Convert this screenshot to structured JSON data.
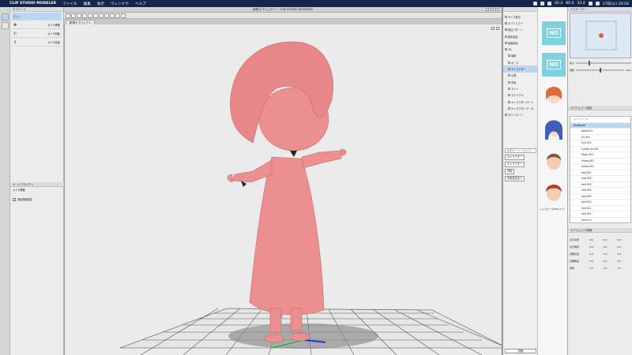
{
  "menubar": {
    "apple": "",
    "app": "CLIP STUDIO MODELER",
    "items": [
      "ファイル",
      "編集",
      "表示",
      "ウィンドウ",
      "ヘルプ"
    ],
    "status": [
      "92.4",
      "80.4",
      "33.4"
    ],
    "clock": "17日(火) 20:54"
  },
  "subtool_panel": {
    "title": "サブツール",
    "items": [
      {
        "label": "ビュー",
        "glyph": "✋"
      },
      {
        "label": "カメラ移動",
        "glyph": "✥"
      },
      {
        "label": "カメラ回転",
        "glyph": "↻"
      },
      {
        "label": "カメラ前後",
        "glyph": "⇕"
      }
    ]
  },
  "tool_property": {
    "title": "ツールプロパティ",
    "subtitle": "カメラ移動",
    "option": "回転角度固定"
  },
  "document": {
    "title": "新規オブジェクト* - CLIP STUDIO MODELER",
    "tab": "新規オブジェクト"
  },
  "object_tree": {
    "items": [
      {
        "label": "サイズ表示",
        "indent": false,
        "selected": false
      },
      {
        "label": "オブジェクト",
        "indent": false,
        "selected": false
      },
      {
        "label": "視点パターン",
        "indent": false,
        "selected": false
      },
      {
        "label": "基本設定",
        "indent": false,
        "selected": false
      },
      {
        "label": "画面設定",
        "indent": false,
        "selected": false
      },
      {
        "label": "3D",
        "indent": false,
        "selected": false
      },
      {
        "label": "頭部",
        "indent": true,
        "selected": false
      },
      {
        "label": "ポーズ",
        "indent": true,
        "selected": false
      },
      {
        "label": "キャラクター",
        "indent": true,
        "selected": true
      },
      {
        "label": "小物",
        "indent": true,
        "selected": false
      },
      {
        "label": "背景",
        "indent": true,
        "selected": false
      },
      {
        "label": "ライト",
        "indent": true,
        "selected": false
      },
      {
        "label": "マテリアル",
        "indent": true,
        "selected": false
      },
      {
        "label": "キャラクターパーツ",
        "indent": true,
        "selected": false
      },
      {
        "label": "キャラクターデータ",
        "indent": true,
        "selected": false
      },
      {
        "label": "ダウンロード",
        "indent": false,
        "selected": false
      }
    ],
    "search_placeholder": "検索キーワードを入力",
    "buttons": [
      "キャラクター",
      "キャラクター",
      "背景",
      "背景設定全て"
    ],
    "bottom_button": "詳細"
  },
  "materials": {
    "no_label": "NO",
    "caption": "シャズキーの3Dキャラ",
    "thumbs": [
      "NO",
      "NO",
      "character-1",
      "character-2",
      "character-3",
      "character-4"
    ]
  },
  "navigator": {
    "title": "ナビゲーター",
    "zoom_label": "拡大",
    "rotate_label": "回転",
    "zoom_value": "90.0"
  },
  "object_list": {
    "title": "オブジェクト構成",
    "header": "ルートノード",
    "selected": "RootNode",
    "parts": [
      "Body.001",
      "En.001",
      "Eye.001",
      "Eyelid-Up.001",
      "Mayu.001",
      "Shoes.001",
      "Under.001",
      "hair.001",
      "hair.002",
      "hair.003",
      "hair.004",
      "hair.005",
      "hair.010",
      "hair.011",
      "hair.012",
      "hair.013"
    ]
  },
  "object_info": {
    "title": "オブジェクト情報",
    "rows": [
      {
        "label": "表示位置",
        "values": [
          "0.0,",
          "0.0,",
          "0.0"
        ]
      },
      {
        "label": "表示角度",
        "values": [
          "0.0,",
          "0.0,",
          "0.0"
        ]
      },
      {
        "label": "初期位置",
        "values": [
          "0.0,",
          "0.0,",
          "0.0"
        ]
      },
      {
        "label": "初期角度",
        "values": [
          "0.0,",
          "0.0,",
          "0.0"
        ]
      },
      {
        "label": "倍率",
        "values": [
          "1.0,",
          "1.0,",
          "1.0"
        ]
      }
    ]
  },
  "colors": {
    "menubar": "#14264a",
    "model": "#ec8f90",
    "model_shadow": "#d8777a",
    "accent": "#7fd1e0",
    "selection": "#bcd6f0"
  }
}
